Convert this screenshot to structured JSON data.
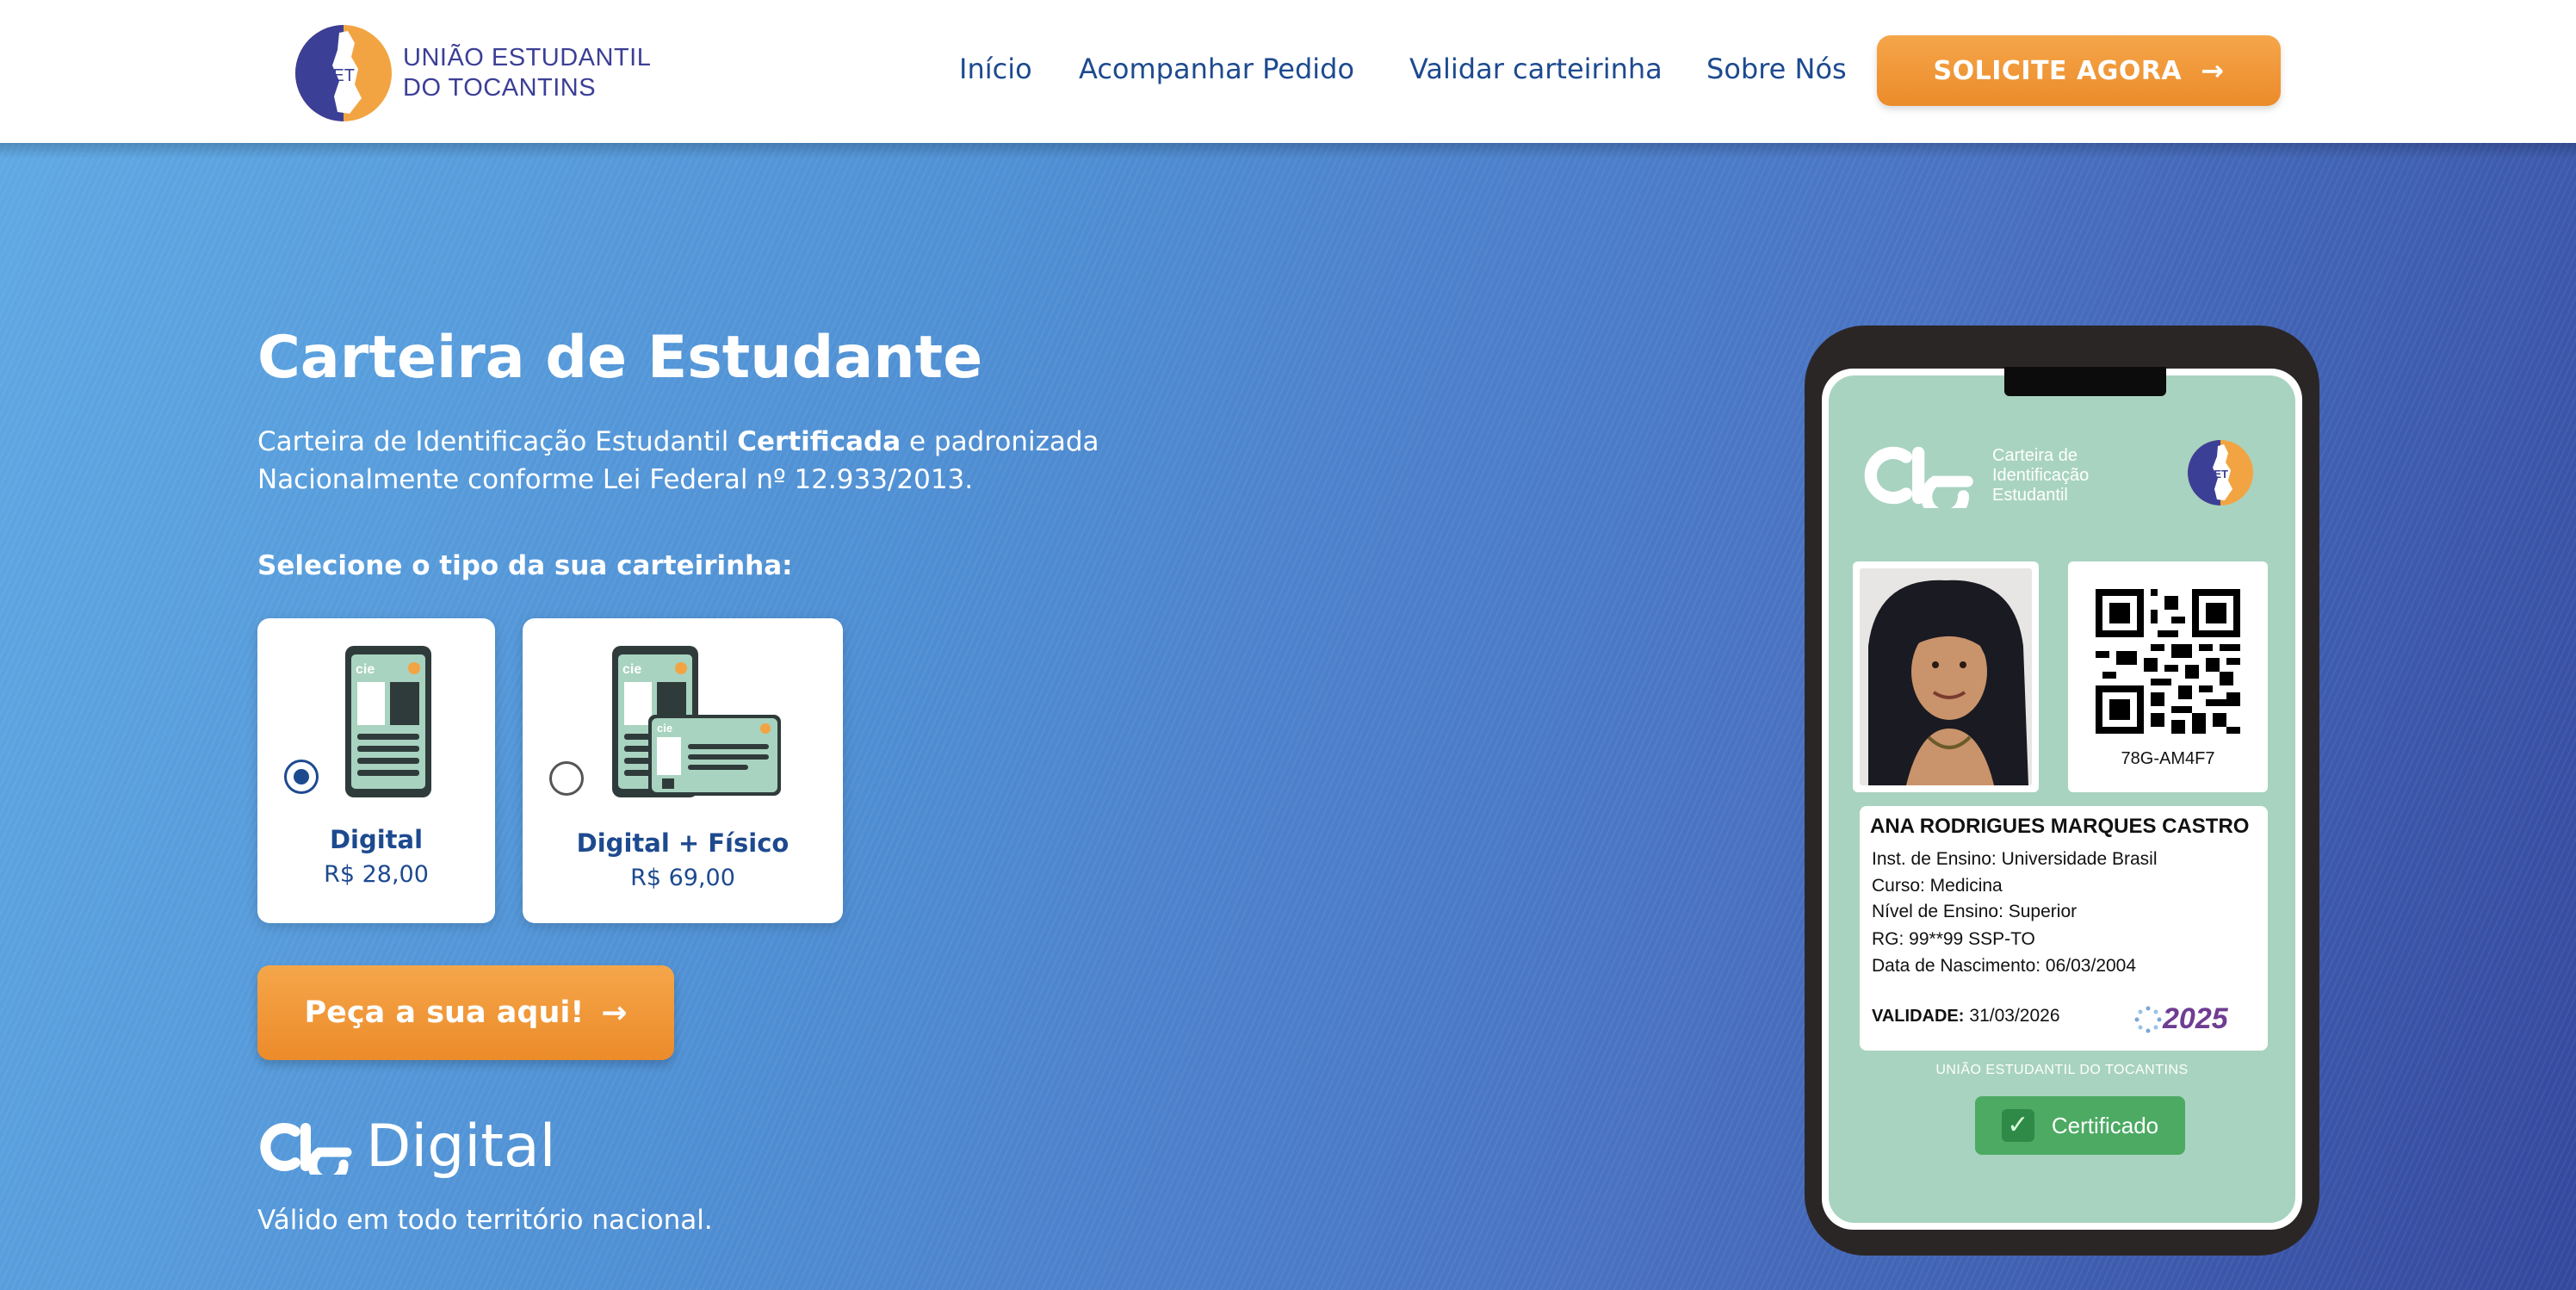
{
  "header": {
    "logo_line1": "UNIÃO ESTUDANTIL",
    "logo_line2": "DO TOCANTINS",
    "logo_mark_text": "UET",
    "nav": [
      "Início",
      "Acompanhar Pedido",
      "Validar carteirinha",
      "Sobre Nós"
    ],
    "cta_label": "SOLICITE AGORA",
    "cta_arrow": "→"
  },
  "hero": {
    "title": "Carteira de Estudante",
    "desc_part1": "Carteira de Identificação Estudantil ",
    "desc_bold": "Certificada",
    "desc_part2": " e padronizada Nacionalmente conforme Lei Federal nº 12.933/2013.",
    "select_label": "Selecione o tipo da sua carteirinha:",
    "options": [
      {
        "name": "Digital",
        "price": "R$ 28,00",
        "selected": true
      },
      {
        "name": "Digital + Físico",
        "price": "R$ 69,00",
        "selected": false
      }
    ],
    "cta_label": "Peça a sua aqui!",
    "cta_arrow": "→",
    "cie_word": "Digital",
    "valid_text": "Válido em todo território nacional."
  },
  "card": {
    "header_line1": "Carteira de",
    "header_line2": "Identificação",
    "header_line3": "Estudantil",
    "badge_text": "UET",
    "qr_id": "78G-AM4F7",
    "name": "ANA RODRIGUES MARQUES CASTRO",
    "institution": "Inst. de Ensino: Universidade Brasil",
    "course": "Curso: Medicina",
    "level": "Nível de Ensino: Superior",
    "rg": "RG: 99**99 SSP-TO",
    "birth": "Data de Nascimento: 06/03/2004",
    "validity_label": "VALIDADE:",
    "validity_value": "31/03/2026",
    "year": "2025",
    "org": "UNIÃO ESTUDANTIL DO TOCANTINS",
    "certified": "Certificado",
    "cert_check": "✓"
  },
  "colors": {
    "accent_orange": "#f0942f",
    "nav_blue": "#1d4a8f",
    "card_green": "#a8d3c0",
    "cert_green": "#4caa63"
  }
}
